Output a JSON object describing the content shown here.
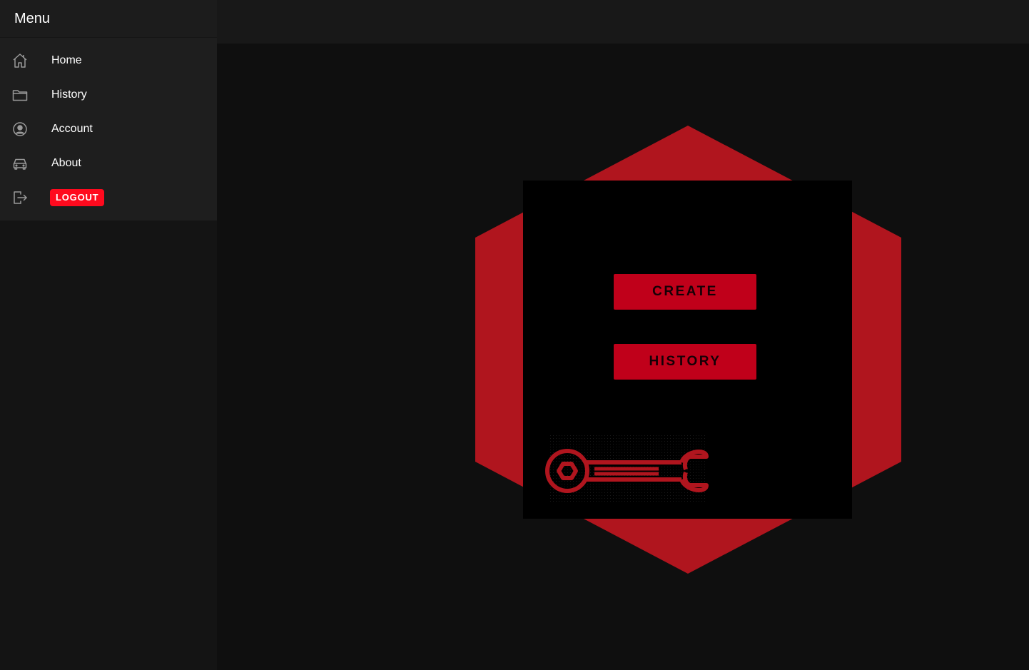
{
  "sidebar": {
    "title": "Menu",
    "items": [
      {
        "label": "Home",
        "icon": "home-icon"
      },
      {
        "label": "History",
        "icon": "folder-icon"
      },
      {
        "label": "Account",
        "icon": "user-circle-icon"
      },
      {
        "label": "About",
        "icon": "car-icon"
      }
    ],
    "logout": {
      "label": "LOGOUT",
      "icon": "logout-icon"
    }
  },
  "main": {
    "buttons": {
      "create_label": "CREATE",
      "history_label": "HISTORY"
    },
    "emblem_icon": "wrench-icon"
  },
  "colors": {
    "accent": "#c0001a",
    "hexagon": "#b0151e",
    "logout": "#ff0a1e",
    "sidebar_bg": "#1e1e1e",
    "main_bg": "#0f0f0f"
  }
}
